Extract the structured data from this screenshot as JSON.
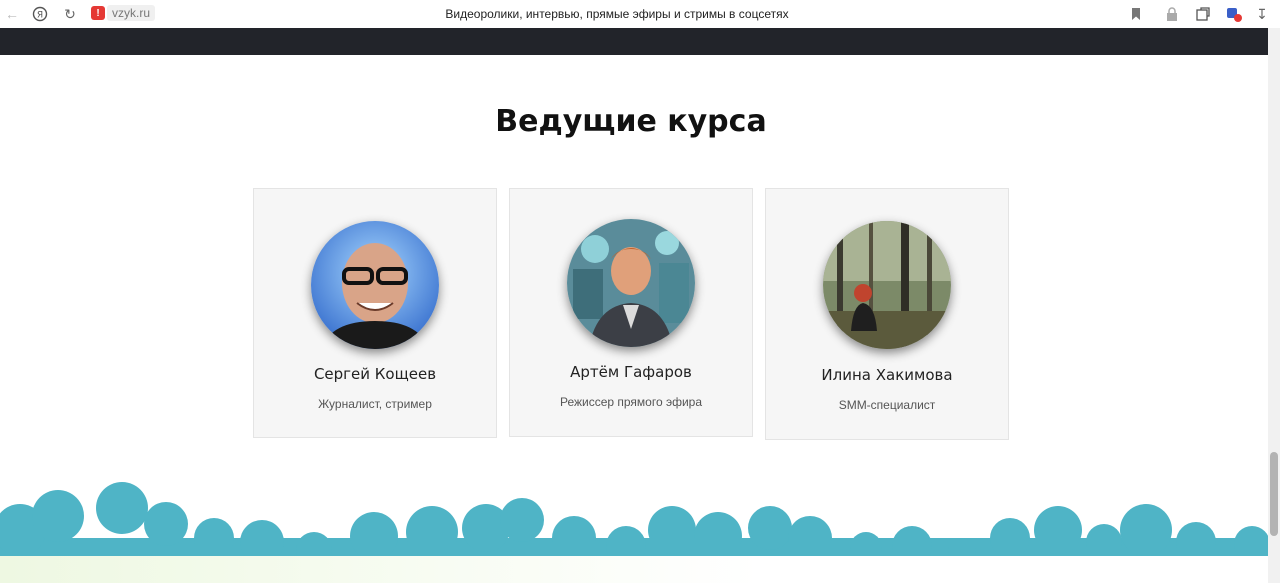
{
  "browser": {
    "url": "vzyk.ru",
    "title": "Видеоролики, интервью, прямые эфиры и стримы в соцсетях",
    "icons": [
      "back-icon",
      "yandex-icon",
      "reload-icon",
      "warning-icon",
      "bookmark-icon",
      "lock-icon",
      "extension-icon",
      "profile-icon",
      "download-icon"
    ]
  },
  "section": {
    "title": "Ведущие курса"
  },
  "hosts": [
    {
      "name": "Сергей Кощеев",
      "role": "Журналист, стример"
    },
    {
      "name": "Артём Гафаров",
      "role": "Режиссер прямого эфира"
    },
    {
      "name": "Илина Хакимова",
      "role": "SMM-специалист"
    }
  ],
  "colors": {
    "dark_strip": "#22242a",
    "clouds": "#4fb4c6",
    "card_bg": "#f6f6f6"
  }
}
